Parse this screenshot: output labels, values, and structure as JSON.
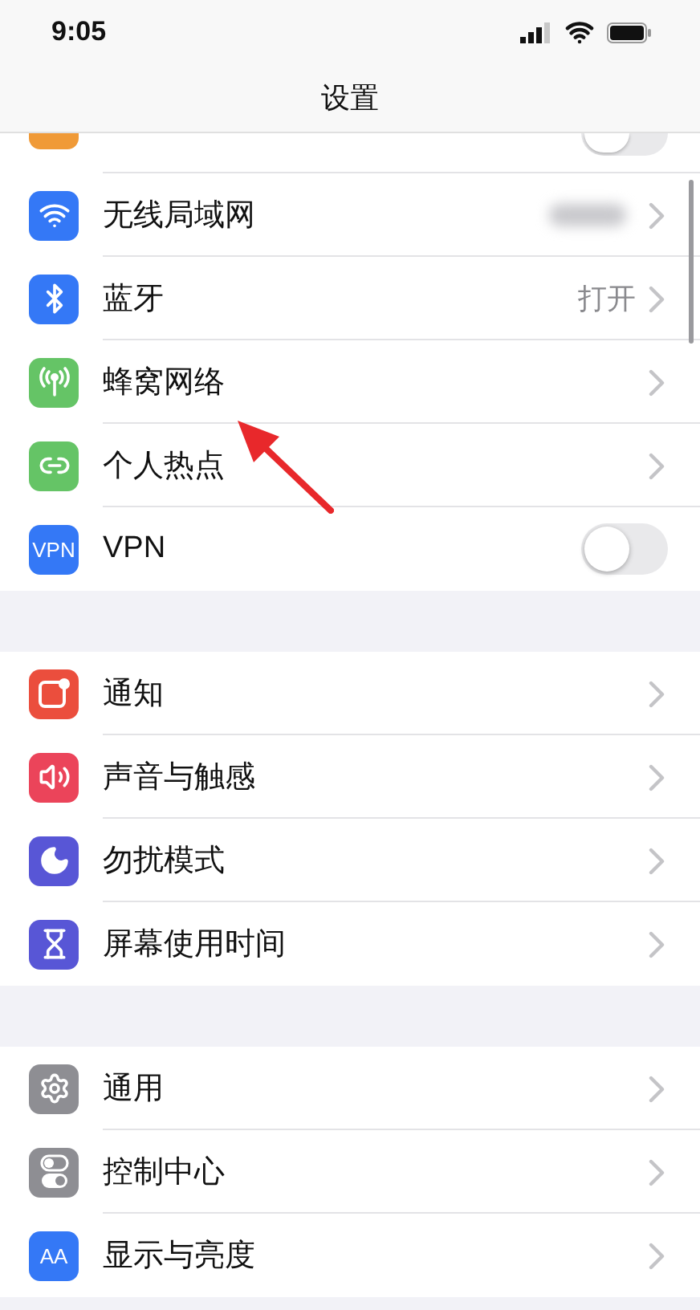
{
  "status_bar": {
    "time": "9:05"
  },
  "nav": {
    "title": "设置"
  },
  "groups": [
    {
      "rows": [
        {
          "kind": "toggle",
          "partial": true,
          "color": "#f09a37",
          "on": false
        },
        {
          "kind": "link",
          "label": "无线局域网",
          "color": "#3478f6",
          "blurred_value": true
        },
        {
          "kind": "link",
          "label": "蓝牙",
          "color": "#3478f6",
          "value": "打开"
        },
        {
          "kind": "link",
          "label": "蜂窝网络",
          "color": "#65c466"
        },
        {
          "kind": "link",
          "label": "个人热点",
          "color": "#65c466"
        },
        {
          "kind": "toggle",
          "label": "VPN",
          "color": "#3478f6",
          "on": false,
          "badge": "VPN"
        }
      ]
    },
    {
      "rows": [
        {
          "kind": "link",
          "label": "通知",
          "color": "#eb4e3d"
        },
        {
          "kind": "link",
          "label": "声音与触感",
          "color": "#eb445a"
        },
        {
          "kind": "link",
          "label": "勿扰模式",
          "color": "#5856d6"
        },
        {
          "kind": "link",
          "label": "屏幕使用时间",
          "color": "#5856d6"
        }
      ]
    },
    {
      "rows": [
        {
          "kind": "link",
          "label": "通用",
          "color": "#8e8e93"
        },
        {
          "kind": "link",
          "label": "控制中心",
          "color": "#8e8e93"
        },
        {
          "kind": "link",
          "label": "显示与亮度",
          "color": "#3478f6",
          "badge": "AA"
        }
      ]
    }
  ]
}
